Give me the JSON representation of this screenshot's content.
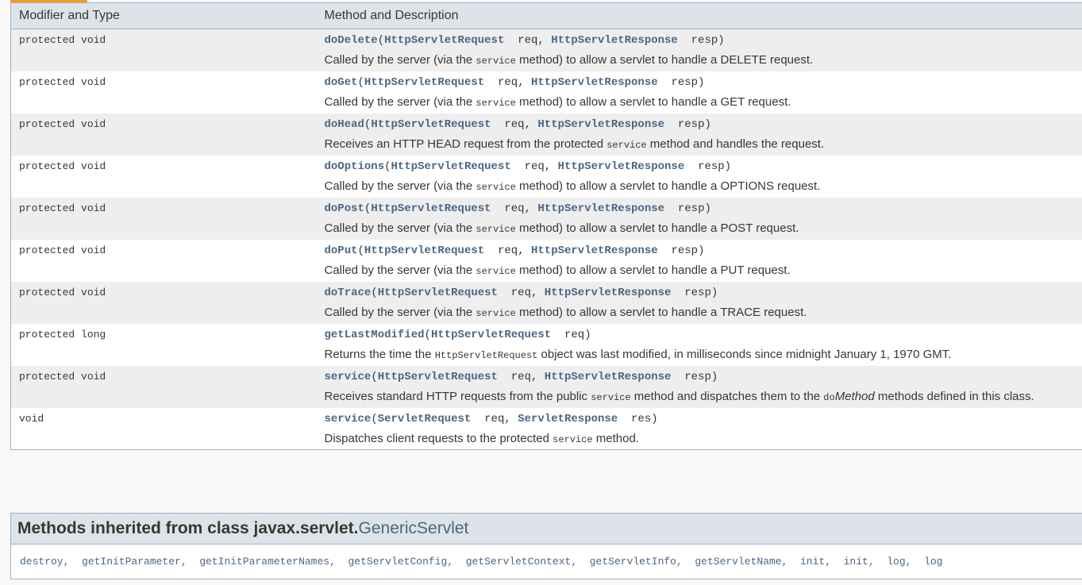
{
  "headers": {
    "modifier": "Modifier and Type",
    "method": "Method and Description"
  },
  "rows": [
    {
      "mod": "protected void",
      "name": "doDelete",
      "params": [
        [
          "HttpServletRequest",
          "req"
        ],
        [
          "HttpServletResponse",
          "resp"
        ]
      ],
      "d1": "Called by the server (via the ",
      "code": "service",
      "d2": " method) to allow a servlet to handle a DELETE request."
    },
    {
      "mod": "protected void",
      "name": "doGet",
      "params": [
        [
          "HttpServletRequest",
          "req"
        ],
        [
          "HttpServletResponse",
          "resp"
        ]
      ],
      "d1": "Called by the server (via the ",
      "code": "service",
      "d2": " method) to allow a servlet to handle a GET request."
    },
    {
      "mod": "protected void",
      "name": "doHead",
      "params": [
        [
          "HttpServletRequest",
          "req"
        ],
        [
          "HttpServletResponse",
          "resp"
        ]
      ],
      "d1": "Receives an HTTP HEAD request from the protected ",
      "code": "service",
      "d2": " method and handles the request."
    },
    {
      "mod": "protected void",
      "name": "doOptions",
      "params": [
        [
          "HttpServletRequest",
          "req"
        ],
        [
          "HttpServletResponse",
          "resp"
        ]
      ],
      "d1": "Called by the server (via the ",
      "code": "service",
      "d2": " method) to allow a servlet to handle a OPTIONS request."
    },
    {
      "mod": "protected void",
      "name": "doPost",
      "params": [
        [
          "HttpServletRequest",
          "req"
        ],
        [
          "HttpServletResponse",
          "resp"
        ]
      ],
      "d1": "Called by the server (via the ",
      "code": "service",
      "d2": " method) to allow a servlet to handle a POST request."
    },
    {
      "mod": "protected void",
      "name": "doPut",
      "params": [
        [
          "HttpServletRequest",
          "req"
        ],
        [
          "HttpServletResponse",
          "resp"
        ]
      ],
      "d1": "Called by the server (via the ",
      "code": "service",
      "d2": " method) to allow a servlet to handle a PUT request."
    },
    {
      "mod": "protected void",
      "name": "doTrace",
      "params": [
        [
          "HttpServletRequest",
          "req"
        ],
        [
          "HttpServletResponse",
          "resp"
        ]
      ],
      "d1": "Called by the server (via the ",
      "code": "service",
      "d2": " method) to allow a servlet to handle a TRACE request."
    },
    {
      "mod": "protected long",
      "name": "getLastModified",
      "params": [
        [
          "HttpServletRequest",
          "req"
        ]
      ],
      "d1": "Returns the time the ",
      "code": "HttpServletRequest",
      "d2": " object was last modified, in milliseconds since midnight January 1, 1970 GMT."
    },
    {
      "mod": "protected void",
      "name": "service",
      "params": [
        [
          "HttpServletRequest",
          "req"
        ],
        [
          "HttpServletResponse",
          "resp"
        ]
      ],
      "d1": "Receives standard HTTP requests from the public ",
      "code": "service",
      "d2": " method and dispatches them to the ",
      "code2": "do",
      "em": "Method",
      "d3": " methods defined in this class."
    },
    {
      "mod": "void",
      "name": "service",
      "params": [
        [
          "ServletRequest",
          "req"
        ],
        [
          "ServletResponse",
          "res"
        ]
      ],
      "d1": "Dispatches client requests to the protected ",
      "code": "service",
      "d2": " method."
    }
  ],
  "inherited": {
    "prefix": "Methods inherited from class javax.servlet.",
    "cls": "GenericServlet",
    "methods": [
      "destroy",
      "getInitParameter",
      "getInitParameterNames",
      "getServletConfig",
      "getServletContext",
      "getServletInfo",
      "getServletName",
      "init",
      "init",
      "log",
      "log"
    ]
  }
}
